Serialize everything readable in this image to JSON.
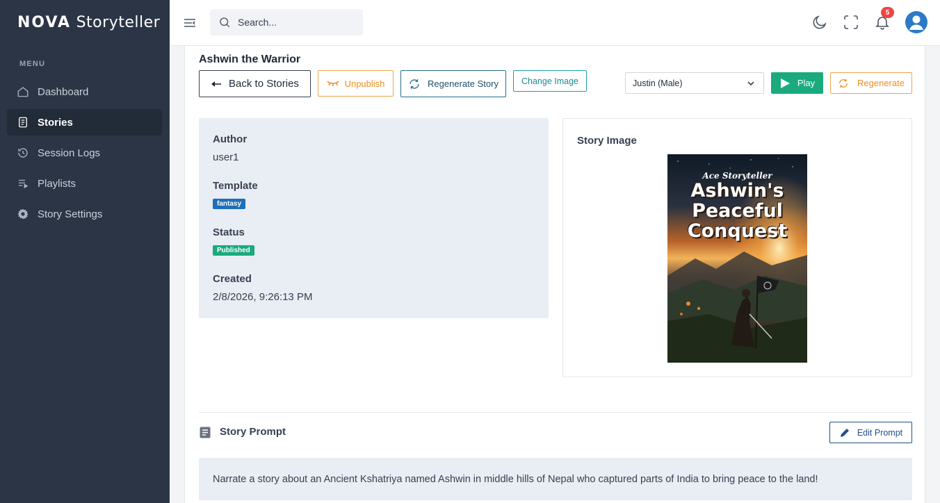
{
  "app": {
    "brand_bold": "NOVA",
    "brand_rest": "Storyteller"
  },
  "sidebar": {
    "menu_label": "MENU",
    "items": [
      {
        "label": "Dashboard",
        "icon": "home-icon",
        "active": false
      },
      {
        "label": "Stories",
        "icon": "document-icon",
        "active": true
      },
      {
        "label": "Session Logs",
        "icon": "history-icon",
        "active": false
      },
      {
        "label": "Playlists",
        "icon": "playlist-icon",
        "active": false
      },
      {
        "label": "Story Settings",
        "icon": "gear-icon",
        "active": false
      }
    ]
  },
  "header": {
    "search_placeholder": "Search...",
    "notification_count": "5",
    "icons": [
      "menu-icon",
      "search-icon",
      "moon-icon",
      "fullscreen-icon",
      "bell-icon",
      "user-icon"
    ]
  },
  "story": {
    "title": "Ashwin the Warrior",
    "actions": {
      "back": "Back to Stories",
      "unpublish": "Unpublish",
      "regenerate_story": "Regenerate Story",
      "change_image": "Change Image",
      "voice_selected": "Justin (Male)",
      "play": "Play",
      "regenerate": "Regenerate"
    },
    "info": {
      "author_label": "Author",
      "author_value": "user1",
      "template_label": "Template",
      "template_value": "fantasy",
      "status_label": "Status",
      "status_value": "Published",
      "created_label": "Created",
      "created_value": "2/8/2026, 9:26:13 PM"
    },
    "image": {
      "label": "Story Image",
      "cover_brand": "Ace Storyteller",
      "cover_title_1": "Ashwin's",
      "cover_title_2": "Peaceful",
      "cover_title_3": "Conquest"
    },
    "prompt": {
      "heading": "Story Prompt",
      "edit_button": "Edit Prompt",
      "text": "Narrate a story about an Ancient Kshatriya named Ashwin in middle hills of Nepal who captured parts of India to bring peace to the land!"
    }
  },
  "colors": {
    "sidebar_bg": "#2b3545",
    "accent_green": "#1aaa7e",
    "accent_orange": "#f08c1e",
    "badge_red": "#ef4444",
    "tag_blue": "#1e6fb8"
  }
}
